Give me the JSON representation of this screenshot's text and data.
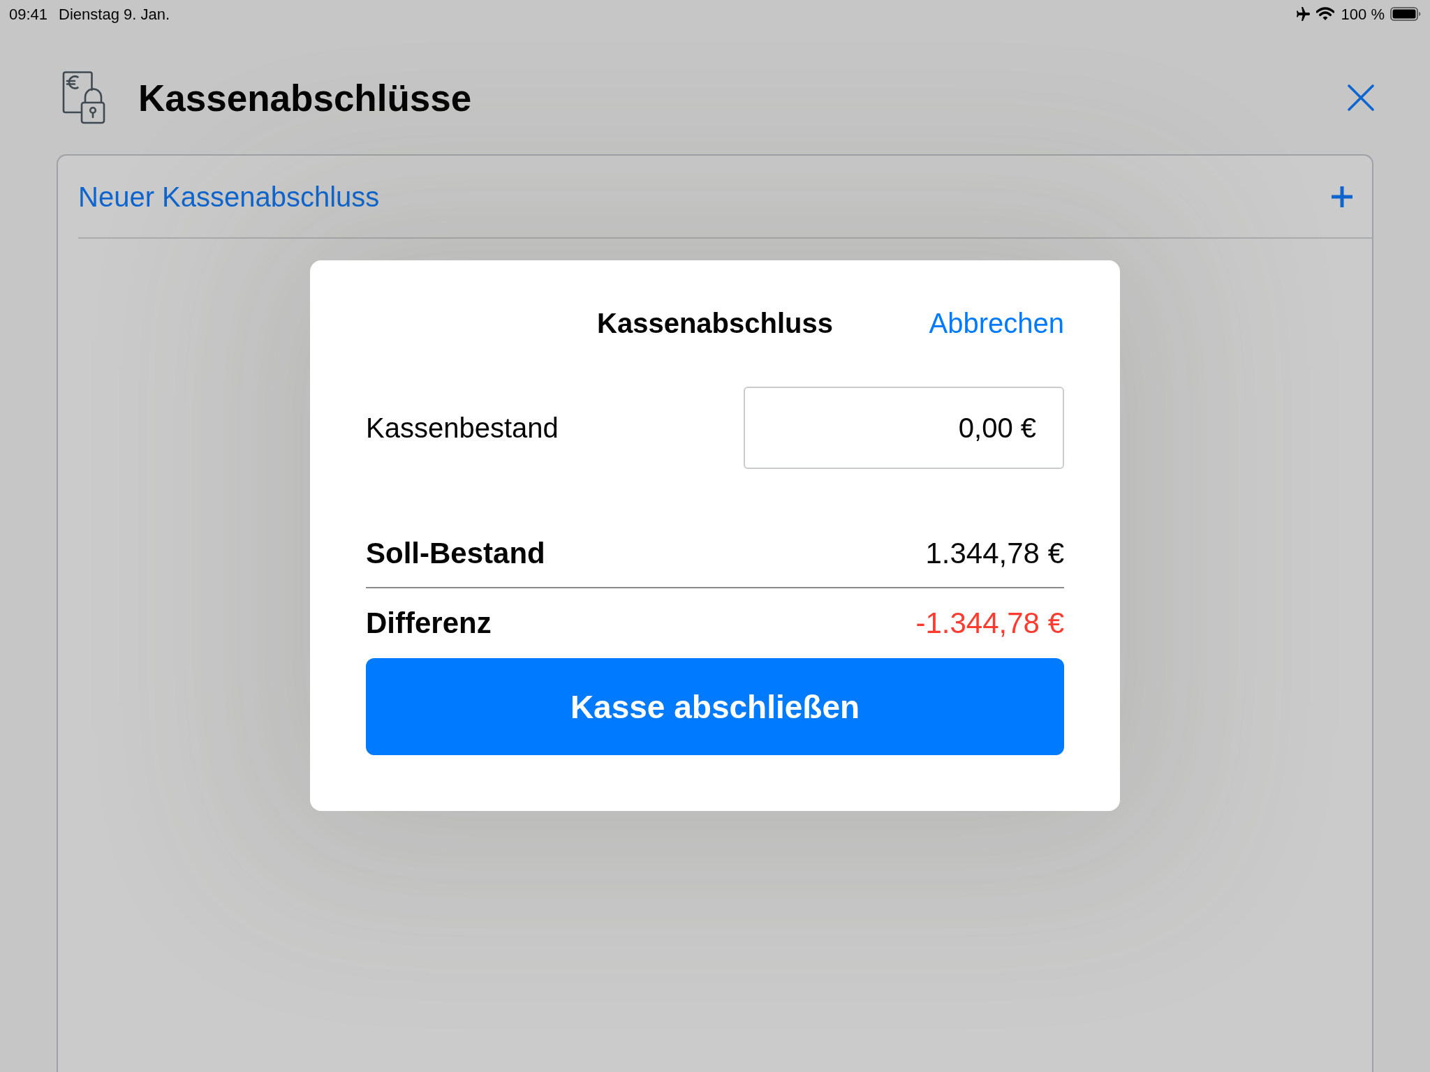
{
  "status_bar": {
    "time": "09:41",
    "date": "Dienstag 9. Jan.",
    "battery": "100 %"
  },
  "header": {
    "title": "Kassenabschlüsse"
  },
  "list": {
    "new_item": "Neuer Kassenabschluss"
  },
  "dialog": {
    "title": "Kassenabschluss",
    "cancel": "Abbrechen",
    "field": {
      "label": "Kassenbestand",
      "value": "0,00 €"
    },
    "summary": [
      {
        "label": "Soll-Bestand",
        "value": "1.344,78 €",
        "kind": "plain"
      },
      {
        "label": "Differenz",
        "value": "-1.344,78 €",
        "kind": "negative"
      }
    ],
    "button": "Kasse abschließen"
  }
}
